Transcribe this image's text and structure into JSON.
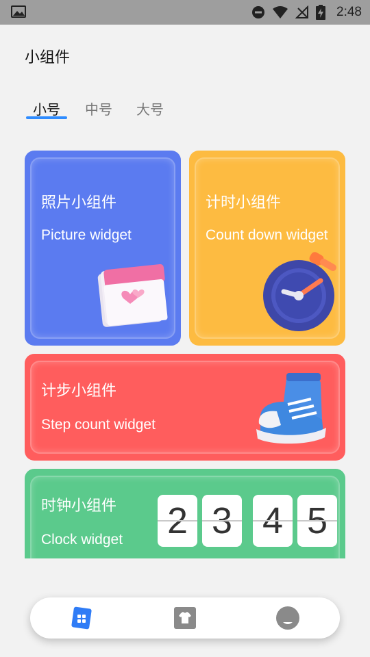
{
  "status_bar": {
    "time": "2:48",
    "icons": [
      "image-icon",
      "do-not-disturb-icon",
      "wifi-icon",
      "no-signal-icon",
      "battery-charging-icon"
    ]
  },
  "page": {
    "title": "小组件"
  },
  "tabs": [
    {
      "label": "小号",
      "active": true
    },
    {
      "label": "中号",
      "active": false
    },
    {
      "label": "大号",
      "active": false
    }
  ],
  "widgets": {
    "picture": {
      "title": "照片小组件",
      "subtitle": "Picture widget",
      "color": "#5b7bf0",
      "icon": "calendar-heart-icon"
    },
    "countdown": {
      "title": "计时小组件",
      "subtitle": "Count down widget",
      "color": "#fdbb41",
      "icon": "stopwatch-icon"
    },
    "step": {
      "title": "计步小组件",
      "subtitle": "Step count widget",
      "color": "#ff5d5d",
      "icon": "sneaker-icon"
    },
    "clock": {
      "title": "时钟小组件",
      "subtitle": "Clock widget",
      "color": "#5bca8c",
      "digits": [
        "2",
        "3",
        "4",
        "5"
      ]
    }
  },
  "bottom_nav": {
    "items": [
      {
        "icon": "widgets-icon",
        "active": true
      },
      {
        "icon": "theme-shirt-icon",
        "active": false
      },
      {
        "icon": "profile-icon",
        "active": false
      }
    ],
    "accent": "#2f7cf6"
  }
}
